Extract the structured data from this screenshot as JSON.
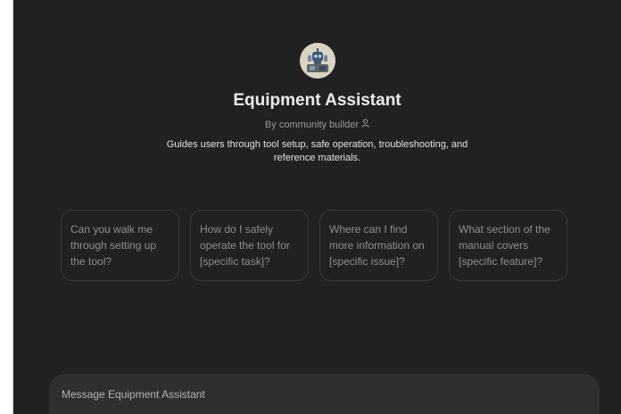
{
  "assistant": {
    "name": "Equipment Assistant",
    "byline": "By community builder",
    "description": "Guides users through tool setup, safe operation, troubleshooting, and reference materials.",
    "avatar_icon": "robot-with-tools-avatar"
  },
  "suggestions": [
    {
      "text": "Can you walk me through setting up the tool?"
    },
    {
      "text": "How do I safely operate the tool for [specific task]?"
    },
    {
      "text": "Where can I find more information on [specific issue]?"
    },
    {
      "text": "What section of the manual covers [specific feature]?"
    }
  ],
  "composer": {
    "placeholder": "Message Equipment Assistant"
  },
  "colors": {
    "background": "#212121",
    "composer": "#2f2f2f",
    "card_border": "#383838"
  }
}
